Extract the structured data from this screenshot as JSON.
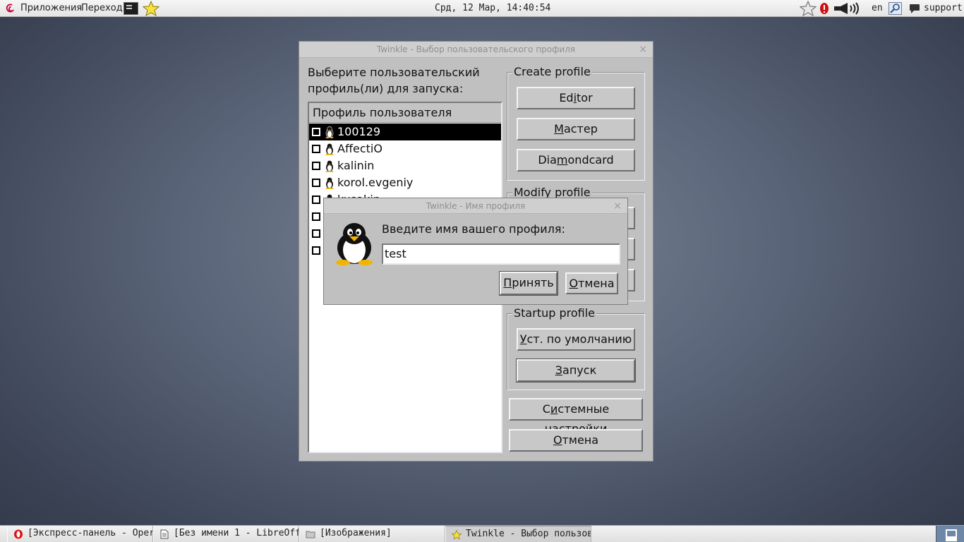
{
  "top_panel": {
    "applications": "Приложения",
    "places": "Переход",
    "clock": "Срд, 12 Мар, 14:40:54",
    "lang": "en",
    "user": "support",
    "icons": [
      "debian-icon",
      "terminal-icon",
      "star-icon",
      "star-outline-icon",
      "alert-icon",
      "volume-icon",
      "search-icon",
      "chat-icon"
    ]
  },
  "main_window": {
    "title": "Twinkle - Выбор пользовательского профиля",
    "prompt_line1": "Выберите пользовательский",
    "prompt_line2": "профиль(ли) для запуска:",
    "list_header": "Профиль пользователя",
    "profiles": [
      {
        "name": "100129",
        "selected": true
      },
      {
        "name": "AffectiO",
        "selected": false
      },
      {
        "name": "kalinin",
        "selected": false
      },
      {
        "name": "korol.evgeniy",
        "selected": false
      },
      {
        "name": "kusakin",
        "selected": false
      }
    ],
    "create_group": "Create profile",
    "editor_button": {
      "pre": "Ed",
      "key": "i",
      "post": "tor"
    },
    "wizard_button": {
      "pre": "",
      "key": "М",
      "post": "астер"
    },
    "diamondcard_button": {
      "pre": "Dia",
      "key": "m",
      "post": "ondcard"
    },
    "modify_group": "Modify profile",
    "startup_group": "Startup profile",
    "default_button": {
      "pre": "",
      "key": "У",
      "post": "ст. по умолчанию"
    },
    "run_button": {
      "pre": "",
      "key": "З",
      "post": "апуск"
    },
    "sysconfig_button": {
      "pre": "С",
      "key": "и",
      "post": "стемные настройки"
    },
    "cancel_button": {
      "pre": "",
      "key": "О",
      "post": "тмена"
    }
  },
  "dialog": {
    "title": "Twinkle - Имя профиля",
    "prompt": "Введите имя вашего профиля:",
    "input_value": "test",
    "accept_button": {
      "pre": "",
      "key": "П",
      "post": "ринять"
    },
    "cancel_button": {
      "pre": "",
      "key": "О",
      "post": "тмена"
    }
  },
  "taskbar": {
    "tasks": [
      {
        "label": "[Экспресс-панель - Oper…",
        "icon": "opera-icon",
        "active": false
      },
      {
        "label": "[Без имени 1 - LibreOff…",
        "icon": "document-icon",
        "active": false
      },
      {
        "label": "[Изображения]",
        "icon": "folder-icon",
        "active": false
      },
      {
        "label": "Twinkle - Выбор пользов…",
        "icon": "twinkle-star-icon",
        "active": true
      }
    ]
  },
  "colors": {
    "selection": "#000000",
    "window_bg": "#c0c0c0",
    "desktop": "#5a6478"
  }
}
